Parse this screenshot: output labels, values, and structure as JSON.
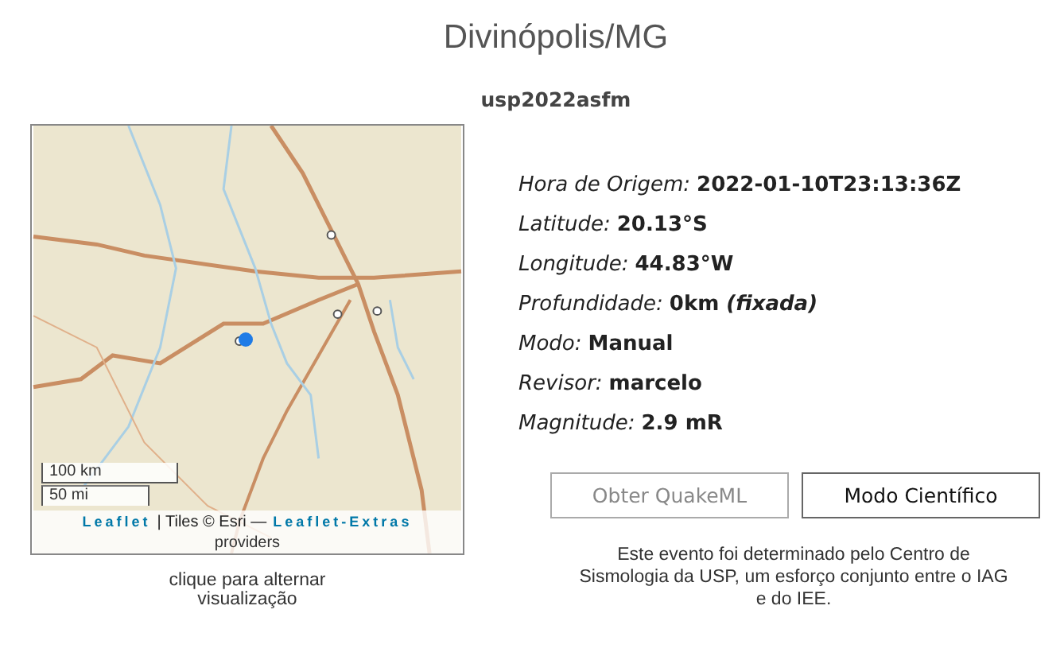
{
  "title": "Divinópolis/MG",
  "event_id": "usp2022asfm",
  "map": {
    "attribution": {
      "leaflet": "Leaflet",
      "tiles": "| Tiles © Esri —",
      "extras": "Leaflet-Extras",
      "providers": "providers"
    },
    "scale": [
      "100 km",
      "50 mi"
    ],
    "caption": "clique para alternar visualização"
  },
  "details": [
    {
      "label": "Hora de Origem:",
      "value": "2022-01-10T23:13:36Z"
    },
    {
      "label": "Latitude:",
      "value": "20.13°S"
    },
    {
      "label": "Longitude:",
      "value": "44.83°W"
    },
    {
      "label": "Profundidade:",
      "value": "0km *(fixada)*"
    },
    {
      "label": "Modo:",
      "value": "Manual"
    },
    {
      "label": "Revisor:",
      "value": "marcelo"
    },
    {
      "label": "Magnitude:",
      "value": "2.9 mR"
    }
  ],
  "buttons": [
    {
      "label": "Obter QuakeML",
      "disabled": true
    },
    {
      "label": "Modo Científico",
      "disabled": false
    }
  ],
  "footnote": "Este evento foi determinado pelo Centro de Sismologia da USP, um esforço conjunto entre o IAG e do IEE."
}
